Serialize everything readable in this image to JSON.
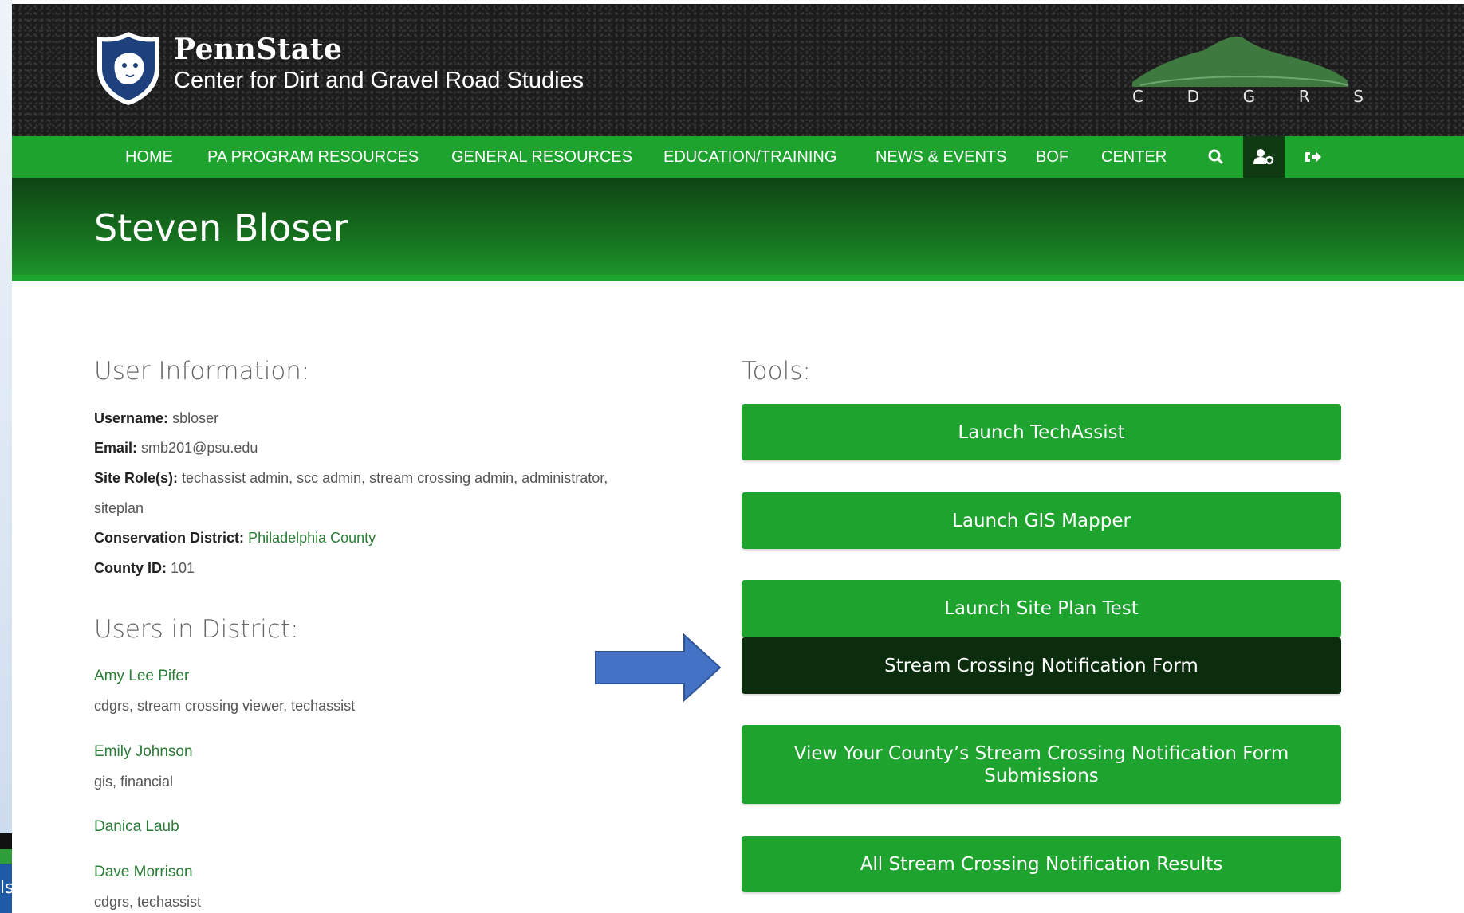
{
  "left_strip_text": "ls",
  "header": {
    "brand_name": "PennState",
    "brand_sub": "Center for Dirt and Gravel Road Studies",
    "cdgrs_letters": [
      "C",
      "D",
      "G",
      "R",
      "S"
    ]
  },
  "nav": {
    "items": [
      "HOME",
      "PA PROGRAM RESOURCES",
      "GENERAL RESOURCES",
      "EDUCATION/TRAINING",
      "NEWS & EVENTS",
      "BOF",
      "CENTER"
    ],
    "icons": [
      "search-icon",
      "user-gear-icon",
      "sign-out-icon"
    ]
  },
  "page_title": "Steven Bloser",
  "user_info": {
    "title": "User Information:",
    "username_label": "Username:",
    "username": "sbloser",
    "email_label": "Email:",
    "email": "smb201@psu.edu",
    "roles_label": "Site Role(s):",
    "roles_line1": "techassist admin, scc admin, stream crossing admin, administrator,",
    "roles_line2": "siteplan",
    "district_label": "Conservation District:",
    "district": "Philadelphia County",
    "county_label": "County ID:",
    "county_id": "101"
  },
  "district_users": {
    "title": "Users in District:",
    "users": [
      {
        "name": "Amy Lee Pifer",
        "roles": "cdgrs, stream crossing viewer, techassist"
      },
      {
        "name": "Emily Johnson",
        "roles": "gis, financial"
      },
      {
        "name": "Danica Laub",
        "roles": ""
      },
      {
        "name": "Dave Morrison",
        "roles": "cdgrs, techassist"
      }
    ]
  },
  "tools": {
    "title": "Tools:",
    "buttons": [
      {
        "label": "Launch TechAssist"
      },
      {
        "label": "Launch GIS Mapper"
      },
      {
        "label": "Launch Site Plan Test"
      },
      {
        "label": "Stream Crossing Notification Form"
      },
      {
        "label": "View Your County’s Stream Crossing Notification Form Submissions"
      },
      {
        "label": "All Stream Crossing Notification Results"
      }
    ]
  },
  "colors": {
    "nav_green": "#1fa32f",
    "dark_green": "#0b2d0e",
    "link_green": "#2a7d36",
    "arrow_blue": "#4472c4"
  }
}
